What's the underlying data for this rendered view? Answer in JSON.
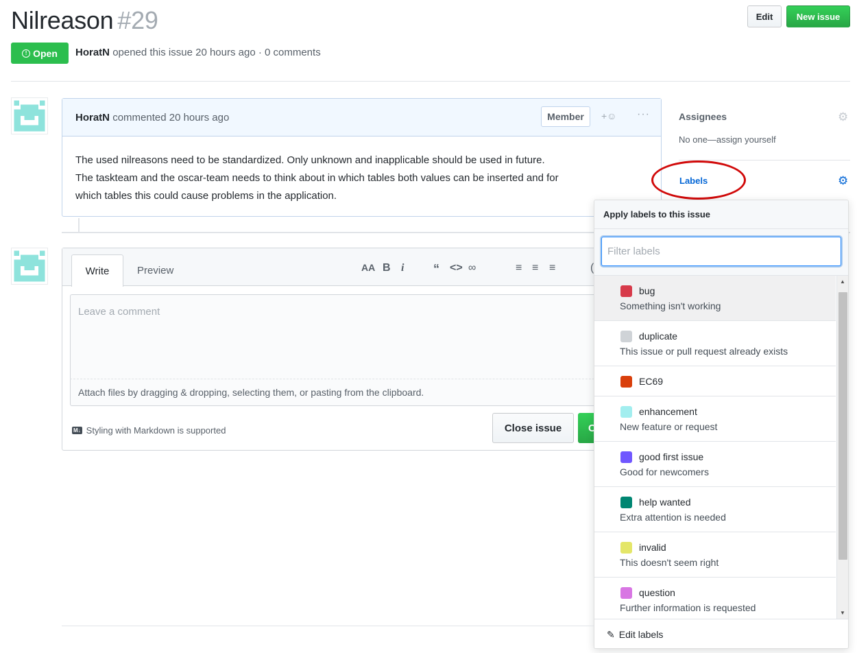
{
  "issue": {
    "title": "Nilreason",
    "number": "#29",
    "state": "Open",
    "author": "HoratN",
    "meta_text": "opened this issue 20 hours ago · 0 comments"
  },
  "header_buttons": {
    "edit": "Edit",
    "new_issue": "New issue"
  },
  "comment": {
    "author": "HoratN",
    "time_text": "commented 20 hours ago",
    "role_badge": "Member",
    "body_line1": "The used nilreasons need to be standardized. Only unknown and inapplicable should be used in future.",
    "body_line2": "The taskteam and the oscar-team needs to think about in which tables both values can be inserted and for",
    "body_line3": "which tables this could cause problems in the application."
  },
  "new_comment": {
    "tab_write": "Write",
    "tab_preview": "Preview",
    "placeholder": "Leave a comment",
    "attach_text": "Attach files by dragging & dropping, selecting them, or pasting from the clipboard.",
    "markdown_text": "Styling with Markdown is supported",
    "markdown_badge": "M↓",
    "close_button": "Close issue",
    "comment_button": "C"
  },
  "sidebar": {
    "assignees_title": "Assignees",
    "assignees_value": "No one—assign yourself",
    "labels_title": "Labels"
  },
  "label_dropdown": {
    "header": "Apply labels to this issue",
    "filter_placeholder": "Filter labels",
    "footer": "Edit labels",
    "labels": [
      {
        "name": "bug",
        "description": "Something isn't working",
        "color": "#d73a4a"
      },
      {
        "name": "duplicate",
        "description": "This issue or pull request already exists",
        "color": "#cfd3d7"
      },
      {
        "name": "EC69",
        "description": "",
        "color": "#d93f0b"
      },
      {
        "name": "enhancement",
        "description": "New feature or request",
        "color": "#a2eeef"
      },
      {
        "name": "good first issue",
        "description": "Good for newcomers",
        "color": "#7057ff"
      },
      {
        "name": "help wanted",
        "description": "Extra attention is needed",
        "color": "#008672"
      },
      {
        "name": "invalid",
        "description": "This doesn't seem right",
        "color": "#e4e669"
      },
      {
        "name": "question",
        "description": "Further information is requested",
        "color": "#d876e3"
      }
    ]
  },
  "colors": {
    "open_green": "#2cbe4e",
    "link_blue": "#0366d6",
    "annotation_red": "#d10a0a",
    "avatar_teal": "#8ee3dc"
  }
}
